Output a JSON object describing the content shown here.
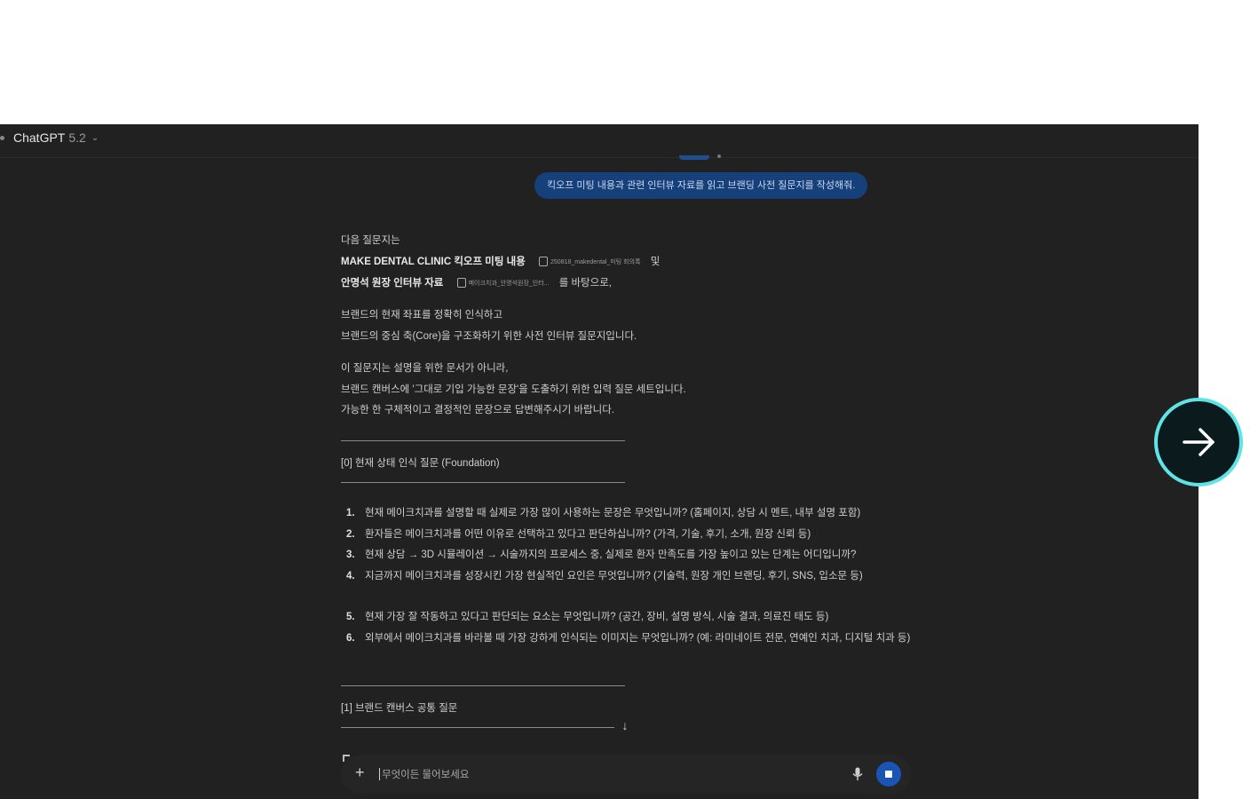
{
  "header": {
    "app_name": "ChatGPT",
    "model_version": "5.2"
  },
  "conversation": {
    "user_message": "킥오프 미팅 내용과 관련 인터뷰 자료를 읽고 브랜딩 사전 질문지를 작성해줘.",
    "intro": {
      "line1": "다음 질문지는",
      "line2_bold": "MAKE DENTAL CLINIC 킥오프 미팅 내용",
      "attachment1": "250818_makedental_미팅 회의록",
      "line2_tail": "및",
      "line3_bold": "안명석 원장 인터뷰 자료",
      "attachment2": "메이크치과_안명석원장_인터...",
      "line3_tail": "를 바탕으로,"
    },
    "para2": [
      "브랜드의 현재 좌표를 정확히 인식하고",
      "브랜드의 중심 축(Core)을 구조화하기 위한 사전 인터뷰 질문지입니다."
    ],
    "para3": [
      "이 질문지는 설명을 위한 문서가 아니라,",
      "브랜드 캔버스에 '그대로 기입 가능한 문장'을 도출하기 위한 입력 질문 세트입니다.",
      "가능한 한 구체적이고 결정적인 문장으로 답변해주시기 바랍니다."
    ],
    "section0_title": "[0] 현재 상태 인식 질문 (Foundation)",
    "section0_questions": [
      {
        "num": "1.",
        "text": "현재 메이크치과를 설명할 때 실제로 가장 많이 사용하는 문장은 무엇입니까? (홈페이지, 상담 시 멘트, 내부 설명 포함)"
      },
      {
        "num": "2.",
        "text": "환자들은 메이크치과를 어떤 이유로 선택하고 있다고 판단하십니까? (가격, 기술, 후기, 소개, 원장 신뢰 등)"
      },
      {
        "num": "3.",
        "text": "현재 상담 → 3D 시뮬레이션 → 시술까지의 프로세스 중, 실제로 환자 만족도를 가장 높이고 있는 단계는 어디입니까?"
      },
      {
        "num": "4.",
        "text": "지금까지 메이크치과를 성장시킨 가장 현실적인 요인은 무엇입니까? (기술력, 원장 개인 브랜딩, 후기, SNS, 입소문 등)"
      },
      {
        "num": "5.",
        "text": "현재 가장 잘 작동하고 있다고 판단되는 요소는 무엇입니까? (공간, 장비, 설명 방식, 시술 결과, 의료진 태도 등)"
      },
      {
        "num": "6.",
        "text": "외부에서 메이크치과를 바라볼 때 가장 강하게 인식되는 이미지는 무엇입니까? (예: 라미네이트 전문, 연예인 치과, 디지털 치과 등)"
      }
    ],
    "section1_title": "[1] 브랜드 캔버스 공통 질문"
  },
  "composer": {
    "placeholder": "무엇이든 물어보세요"
  },
  "icons": {
    "add": "plus-icon",
    "mic": "microphone-icon",
    "stop": "stop-icon",
    "scroll": "arrow-down-icon",
    "next": "arrow-right-icon"
  },
  "colors": {
    "background": "#212121",
    "user_bubble": "#16407a",
    "stop_button": "#1a54b4",
    "next_ring": "#5fe3e6"
  }
}
